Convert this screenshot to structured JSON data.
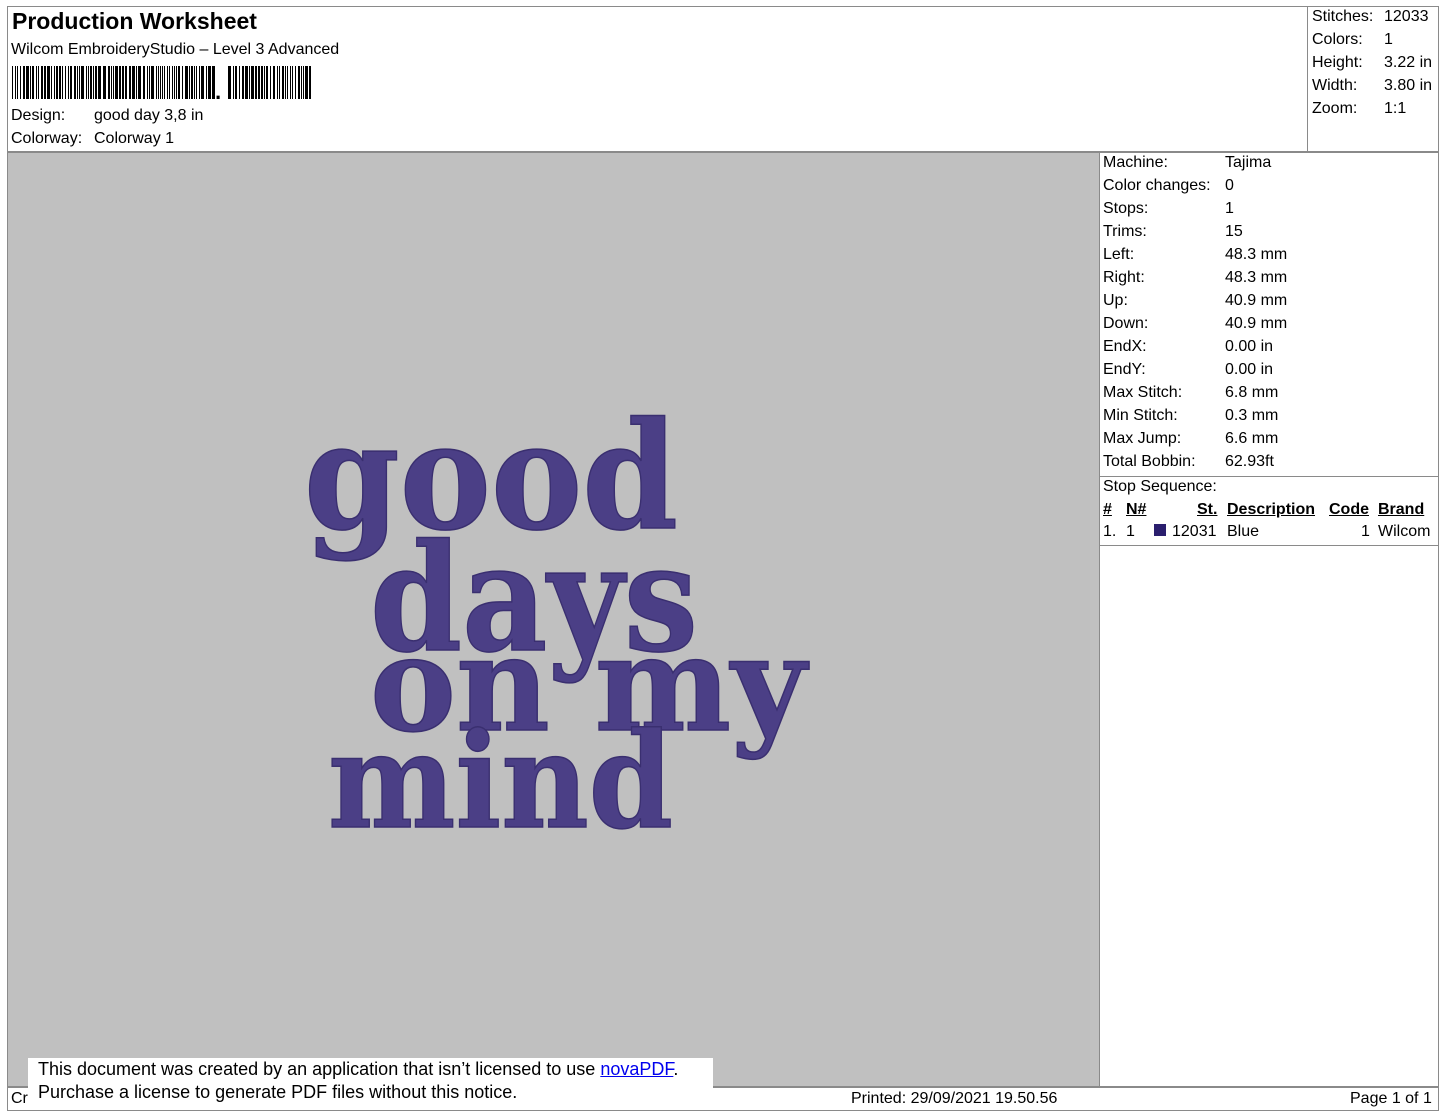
{
  "header": {
    "title": "Production Worksheet",
    "software": "Wilcom EmbroideryStudio – Level 3 Advanced",
    "design_label": "Design:",
    "design_value": "good day 3,8 in",
    "colorway_label": "Colorway:",
    "colorway_value": "Colorway 1"
  },
  "stats": [
    {
      "label": "Stitches:",
      "value": "12033"
    },
    {
      "label": "Colors:",
      "value": "1"
    },
    {
      "label": "Height:",
      "value": "3.22 in"
    },
    {
      "label": "Width:",
      "value": "3.80 in"
    },
    {
      "label": "Zoom:",
      "value": "1:1"
    }
  ],
  "embroidery": {
    "lines": [
      "good",
      "days",
      "on my",
      "mind"
    ],
    "thread_color": "#4b3f86"
  },
  "machine_info": [
    {
      "label": "Machine:",
      "value": "Tajima"
    },
    {
      "label": "Color changes:",
      "value": "0"
    },
    {
      "label": "Stops:",
      "value": "1"
    },
    {
      "label": "Trims:",
      "value": "15"
    },
    {
      "label": "Left:",
      "value": "48.3 mm"
    },
    {
      "label": "Right:",
      "value": "48.3 mm"
    },
    {
      "label": "Up:",
      "value": "40.9 mm"
    },
    {
      "label": "Down:",
      "value": "40.9 mm"
    },
    {
      "label": "EndX:",
      "value": "0.00 in"
    },
    {
      "label": "EndY:",
      "value": "0.00 in"
    },
    {
      "label": "Max Stitch:",
      "value": "6.8 mm"
    },
    {
      "label": "Min Stitch:",
      "value": "0.3 mm"
    },
    {
      "label": "Max Jump:",
      "value": "6.6 mm"
    },
    {
      "label": "Total Bobbin:",
      "value": "62.93ft"
    }
  ],
  "stop_sequence": {
    "title": "Stop Sequence:",
    "headers": {
      "num": "#",
      "n": "N#",
      "st": "St.",
      "description": "Description",
      "code": "Code",
      "brand": "Brand"
    },
    "rows": [
      {
        "num": "1.",
        "n": "1",
        "swatch_color": "#2a1f6e",
        "st": "12031",
        "description": "Blue",
        "code": "1",
        "brand": "Wilcom"
      }
    ]
  },
  "footer": {
    "left": "Cr",
    "printed": "Printed: 29/09/2021 19.50.56",
    "page": "Page 1 of 1"
  },
  "notice": {
    "line1_pre": "This document was created by an application that isn’t licensed to use ",
    "link": "novaPDF",
    "line1_post": ".",
    "line2": "Purchase a license to generate PDF files without this notice."
  }
}
